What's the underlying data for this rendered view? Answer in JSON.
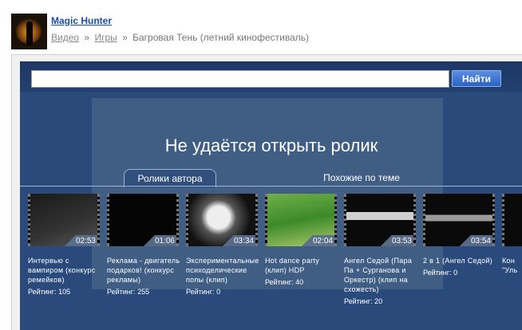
{
  "header": {
    "user_name": "Magic Hunter",
    "breadcrumbs": [
      {
        "label": "Видео"
      },
      {
        "label": "Игры"
      },
      {
        "label": "Багровая Тень (летний кинофестиваль)"
      }
    ],
    "separator": "»"
  },
  "search": {
    "value": "",
    "button_label": "Найти"
  },
  "error": {
    "message": "Не удаётся открыть ролик"
  },
  "tabs": [
    {
      "label": "Ролики автора",
      "active": true
    },
    {
      "label": "Похожие по теме",
      "active": false
    }
  ],
  "rating_label": "Рейтинг:",
  "videos": [
    {
      "title": "Интервью с вампиром (конкурс ремейков)",
      "duration": "02:53",
      "rating": "105",
      "thumb_style": "dark-text"
    },
    {
      "title": "Реклама - двигатель подарков! (конкурс рекламы)",
      "duration": "01:06",
      "rating": "255",
      "thumb_style": "black"
    },
    {
      "title": "Экспериментальные психоделические попы (клип)",
      "duration": "03:34",
      "rating": "0",
      "thumb_style": "bw-figure"
    },
    {
      "title": "Hot dance party (клип) HDP",
      "duration": "02:04",
      "rating": "40",
      "thumb_style": "green-game"
    },
    {
      "title": "Ангел Седой (Пара Па + Сурганова и Оркестр) (клип на схожесть)",
      "duration": "03:53",
      "rating": "20",
      "thumb_style": "dark-shapes"
    },
    {
      "title": "2 в 1 (Ангел Седой)",
      "duration": "03:54",
      "rating": "0",
      "thumb_style": "dark-shapes2"
    },
    {
      "title": "Кон \"Уль",
      "duration": "",
      "rating": "",
      "thumb_style": "partial"
    }
  ]
}
